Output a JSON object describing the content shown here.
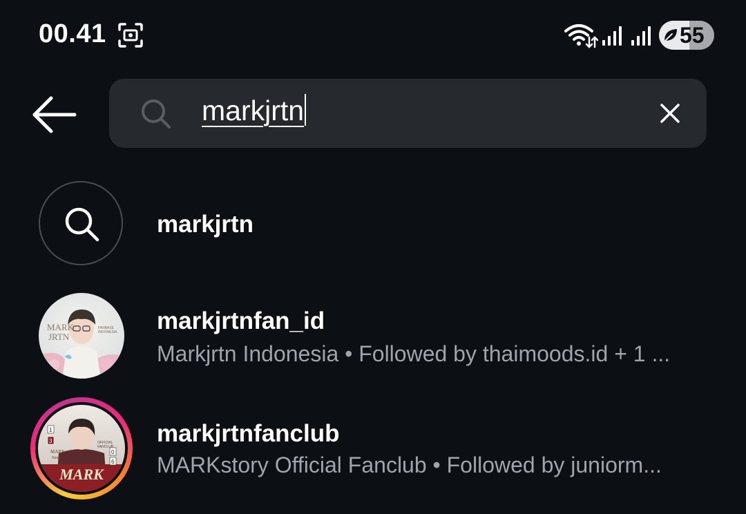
{
  "status_bar": {
    "time": "00.41",
    "battery_level": "55",
    "battery_fraction": 0.55,
    "icons": [
      "screen-record-icon",
      "wifi-icon",
      "signal-icon",
      "signal-icon",
      "battery-leaf-icon"
    ]
  },
  "search": {
    "value": "markjrtn",
    "icon": "search-icon",
    "clear_icon": "close-icon",
    "back_icon": "arrow-left-icon"
  },
  "results": {
    "keyword": {
      "label": "markjrtn",
      "icon": "search-icon"
    },
    "accounts": [
      {
        "username": "markjrtnfan_id",
        "subtitle": "Markjrtn Indonesia • Followed by thaimoods.id + 1 ...",
        "avatar_text": [
          "MARK",
          "JRTN",
          "FANBASE",
          "INDONESIA"
        ],
        "has_story": false
      },
      {
        "username": "markjrtnfanclub",
        "subtitle": "MARKstory Official Fanclub • Followed by juniorm...",
        "avatar_text": [
          "MARK",
          "Story",
          "OFFICIAL",
          "FANCLUB",
          "MARK",
          "1",
          "3",
          "0",
          "6"
        ],
        "has_story": true
      }
    ]
  },
  "colors": {
    "background": "#0c0f14",
    "search_field": "#26292e",
    "secondary_text": "#a0a4ab",
    "story_ring": [
      "#f9ce34",
      "#ee2a7b",
      "#c1358f",
      "#f58529"
    ]
  }
}
